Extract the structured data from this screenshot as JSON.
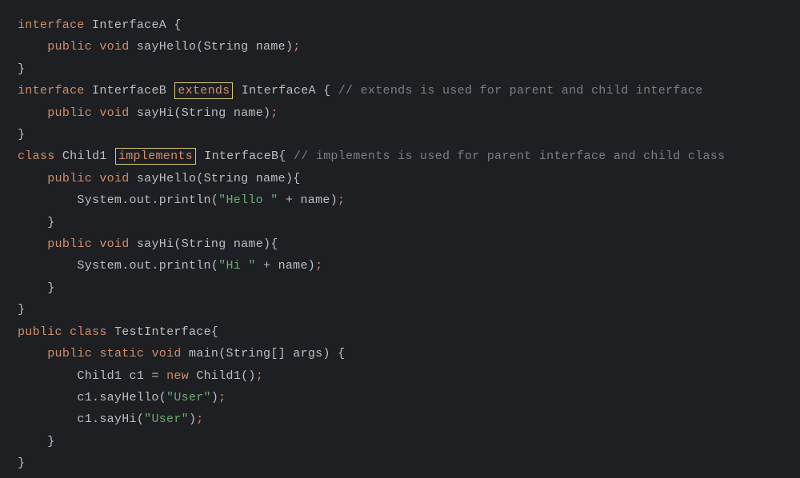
{
  "lines": {
    "l1_kw1": "interface",
    "l1_name": "InterfaceA",
    "l1_brace": "{",
    "l2_kw1": "public",
    "l2_kw2": "void",
    "l2_method": "sayHello",
    "l2_ptype": "String",
    "l2_pname": "name",
    "l3_brace": "}",
    "l4_kw1": "interface",
    "l4_name": "InterfaceB",
    "l4_extends": "extends",
    "l4_parent": "InterfaceA",
    "l4_brace": "{",
    "l4_comment": "// extends is used for parent and child interface",
    "l5_kw1": "public",
    "l5_kw2": "void",
    "l5_method": "sayHi",
    "l5_ptype": "String",
    "l5_pname": "name",
    "l6_brace": "}",
    "l7_kw1": "class",
    "l7_name": "Child1",
    "l7_implements": "implements",
    "l7_parent": "InterfaceB",
    "l7_brace": "{",
    "l7_comment": "// implements is used for parent interface and child class",
    "l8_kw1": "public",
    "l8_kw2": "void",
    "l8_method": "sayHello",
    "l8_ptype": "String",
    "l8_pname": "name",
    "l8_brace": "{",
    "l9_obj": "System.out.println(",
    "l9_str": "\"Hello \"",
    "l9_plus": " + name)",
    "l10_brace": "}",
    "l11_kw1": "public",
    "l11_kw2": "void",
    "l11_method": "sayHi",
    "l11_ptype": "String",
    "l11_pname": "name",
    "l11_brace": "{",
    "l12_obj": "System.out.println(",
    "l12_str": "\"Hi \"",
    "l12_plus": " + name)",
    "l13_brace": "}",
    "l14_brace": "}",
    "l15_kw1": "public",
    "l15_kw2": "class",
    "l15_name": "TestInterface",
    "l15_brace": "{",
    "l16_kw1": "public",
    "l16_kw2": "static",
    "l16_kw3": "void",
    "l16_method": "main",
    "l16_ptype": "String[]",
    "l16_pname": "args",
    "l16_brace": "{",
    "l17_type": "Child1",
    "l17_var": "c1",
    "l17_eq": "=",
    "l17_new": "new",
    "l17_ctor": "Child1()",
    "l18_call": "c1.sayHello(",
    "l18_str": "\"User\"",
    "l18_close": ")",
    "l19_call": "c1.sayHi(",
    "l19_str": "\"User\"",
    "l19_close": ")",
    "l20_brace": "}",
    "l21_brace": "}",
    "semi": ";"
  }
}
